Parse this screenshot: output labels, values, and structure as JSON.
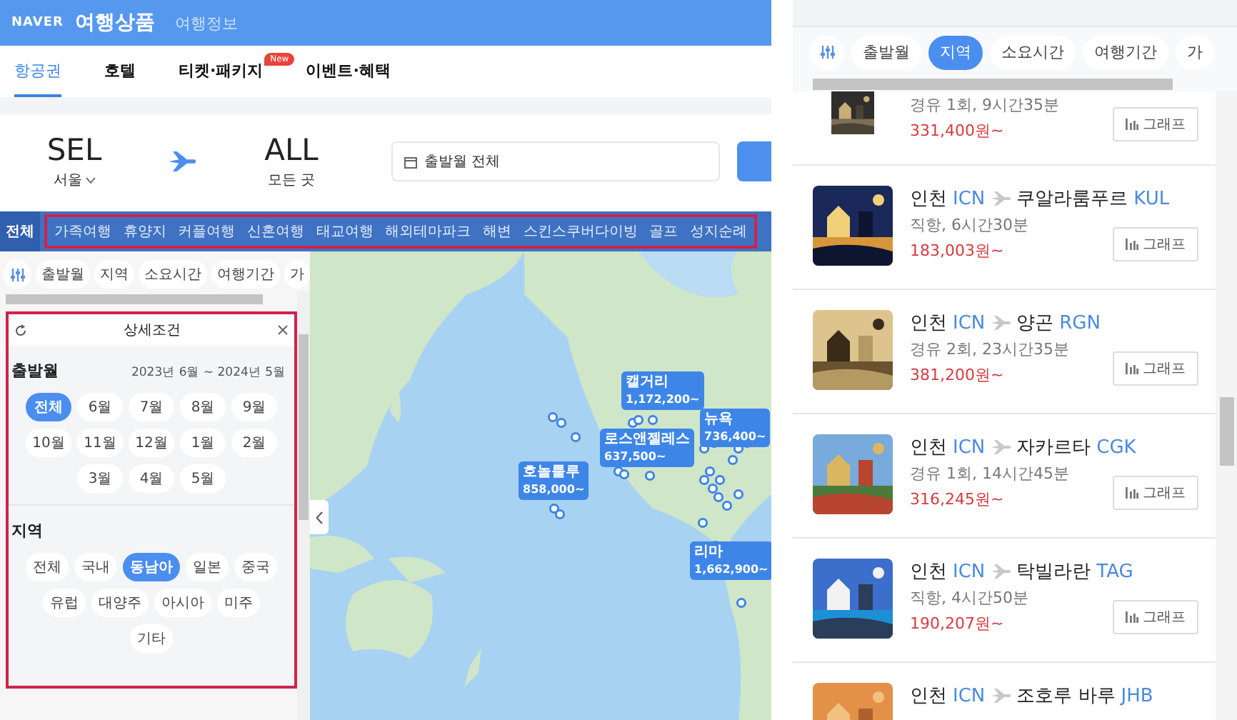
{
  "travel_site": {
    "header": {
      "logo": "NAVER",
      "service": "여행상품",
      "link": "여행정보"
    },
    "tabs": [
      {
        "label": "항공권",
        "selected": true
      },
      {
        "label": "호텔",
        "selected": false
      },
      {
        "label": "티켓·패키지",
        "selected": false,
        "badge": "New"
      },
      {
        "label": "이벤트·혜택",
        "selected": false
      }
    ],
    "search": {
      "origin_code": "SEL",
      "origin_name": "서울",
      "destination_code": "ALL",
      "destination_name": "모든 곳",
      "date_field": "출발월 전체"
    },
    "categories": [
      {
        "label": "전체",
        "selected": true
      },
      {
        "label": "가족여행",
        "selected": false
      },
      {
        "label": "휴양지",
        "selected": false
      },
      {
        "label": "커플여행",
        "selected": false
      },
      {
        "label": "신혼여행",
        "selected": false
      },
      {
        "label": "태교여행",
        "selected": false
      },
      {
        "label": "해외테마파크",
        "selected": false
      },
      {
        "label": "해변",
        "selected": false
      },
      {
        "label": "스킨스쿠버다이빙",
        "selected": false
      },
      {
        "label": "골프",
        "selected": false
      },
      {
        "label": "성지순례",
        "selected": false
      }
    ],
    "filter_chips": [
      {
        "label": "출발월",
        "selected": false
      },
      {
        "label": "지역",
        "selected": false
      },
      {
        "label": "소요시간",
        "selected": false
      },
      {
        "label": "여행기간",
        "selected": false
      },
      {
        "label": "가",
        "selected": false
      }
    ],
    "detail_panel": {
      "title": "상세조건",
      "month_section": {
        "title": "출발월",
        "range": "2023년 6월 ~ 2024년 5월",
        "options": [
          {
            "label": "전체",
            "selected": true
          },
          {
            "label": "6월",
            "selected": false
          },
          {
            "label": "7월",
            "selected": false
          },
          {
            "label": "8월",
            "selected": false
          },
          {
            "label": "9월",
            "selected": false
          },
          {
            "label": "10월",
            "selected": false
          },
          {
            "label": "11월",
            "selected": false
          },
          {
            "label": "12월",
            "selected": false
          },
          {
            "label": "1월",
            "selected": false
          },
          {
            "label": "2월",
            "selected": false
          },
          {
            "label": "3월",
            "selected": false
          },
          {
            "label": "4월",
            "selected": false
          },
          {
            "label": "5월",
            "selected": false
          }
        ]
      },
      "region_section": {
        "title": "지역",
        "options": [
          {
            "label": "전체",
            "selected": false
          },
          {
            "label": "국내",
            "selected": false
          },
          {
            "label": "동남아",
            "selected": true
          },
          {
            "label": "일본",
            "selected": false
          },
          {
            "label": "중국",
            "selected": false
          },
          {
            "label": "유럽",
            "selected": false
          },
          {
            "label": "대양주",
            "selected": false
          },
          {
            "label": "아시아",
            "selected": false
          },
          {
            "label": "미주",
            "selected": false
          },
          {
            "label": "기타",
            "selected": false
          }
        ]
      }
    },
    "map_markers": [
      {
        "city": "캘거리",
        "price": "1,172,200~"
      },
      {
        "city": "로스앤젤레스",
        "price": "637,500~"
      },
      {
        "city": "뉴욕",
        "price": "736,400~"
      },
      {
        "city": "호놀룰루",
        "price": "858,000~"
      },
      {
        "city": "리마",
        "price": "1,662,900~"
      }
    ]
  },
  "flight_list": {
    "filter_chips": [
      {
        "label": "출발월",
        "selected": false
      },
      {
        "label": "지역",
        "selected": true
      },
      {
        "label": "소요시간",
        "selected": false
      },
      {
        "label": "여행기간",
        "selected": false
      },
      {
        "label": "가",
        "selected": false
      }
    ],
    "results": [
      {
        "stops": "경유 1회, 9시간35분",
        "price": "331,400원~",
        "button": "그래프"
      },
      {
        "from": "인천",
        "from_code": "ICN",
        "to": "쿠알라룸푸르",
        "to_code": "KUL",
        "stops": "직항, 6시간30분",
        "price": "183,003원~",
        "button": "그래프"
      },
      {
        "from": "인천",
        "from_code": "ICN",
        "to": "양곤",
        "to_code": "RGN",
        "stops": "경유 2회, 23시간35분",
        "price": "381,200원~",
        "button": "그래프"
      },
      {
        "from": "인천",
        "from_code": "ICN",
        "to": "자카르타",
        "to_code": "CGK",
        "stops": "경유 1회, 14시간45분",
        "price": "316,245원~",
        "button": "그래프"
      },
      {
        "from": "인천",
        "from_code": "ICN",
        "to": "탁빌라란",
        "to_code": "TAG",
        "stops": "직항, 4시간50분",
        "price": "190,207원~",
        "button": "그래프"
      },
      {
        "from": "인천",
        "from_code": "ICN",
        "to": "조호루 바루",
        "to_code": "JHB"
      }
    ]
  }
}
